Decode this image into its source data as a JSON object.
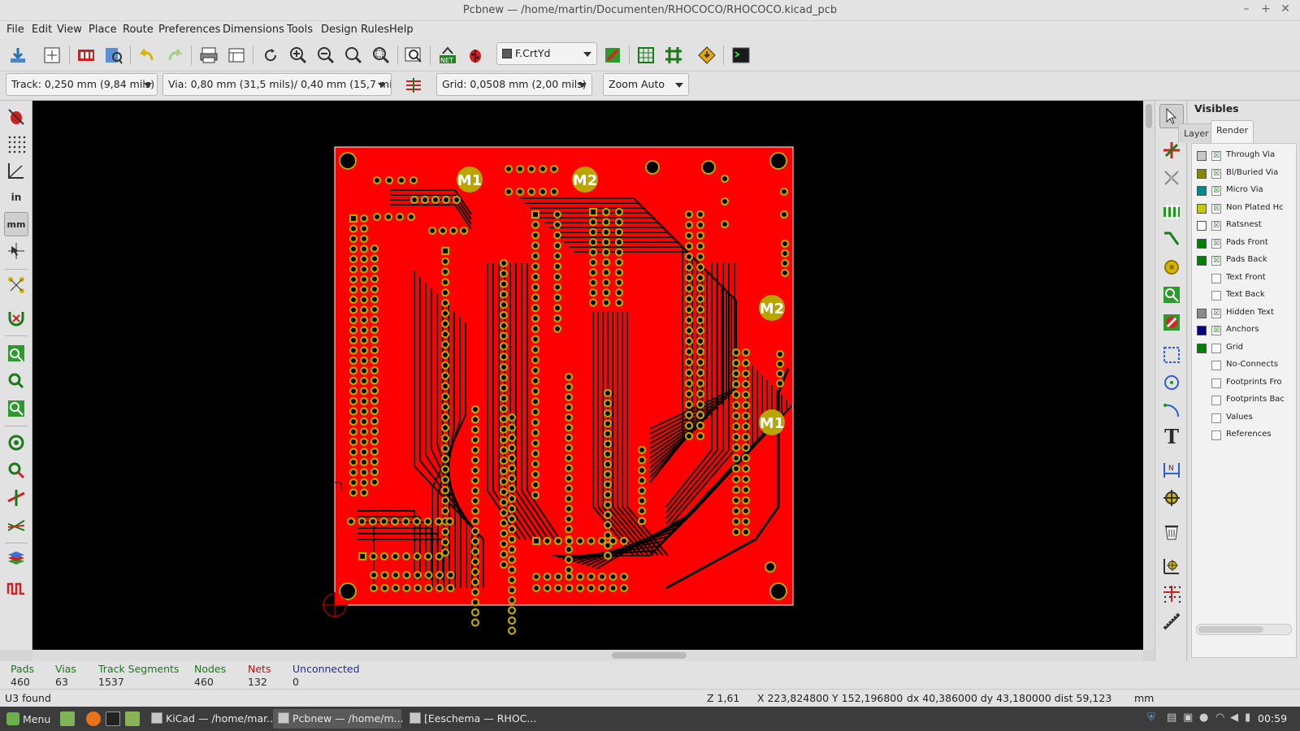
{
  "window": {
    "title": "Pcbnew — /home/martin/Documenten/RHOCOCO/RHOCOCO.kicad_pcb",
    "controls": [
      "–",
      "+",
      "✕"
    ]
  },
  "menu": [
    "File",
    "Edit",
    "View",
    "Place",
    "Route",
    "Preferences",
    "Dimensions",
    "Tools",
    "Design Rules",
    "Help"
  ],
  "toolbar": {
    "layer_select": "F.CrtYd",
    "layer_swatch_color": "#5a5a5a",
    "icons": [
      "save-board-icon",
      "page-settings-icon",
      "load-module-icon",
      "library-browser-icon",
      "undo-icon",
      "redo-icon",
      "print-icon",
      "plot-icon",
      "redraw-icon",
      "zoom-in-icon",
      "zoom-out-icon",
      "zoom-fit-icon",
      "zoom-selection-icon",
      "find-icon",
      "netlist-icon",
      "drc-icon",
      "layer-pair-icon",
      "autoplace-icon",
      "autoroute-icon",
      "microwave-icon",
      "scripting-console-icon"
    ]
  },
  "toolbar2": {
    "track": "Track: 0,250 mm (9,84 mils) *",
    "via": "Via: 0,80 mm (31,5 mils)/ 0,40 mm (15,7 mils) *",
    "grid": "Grid: 0,0508 mm (2,00 mils)",
    "zoom": "Zoom Auto"
  },
  "board": {
    "copper_color": "#ff0000",
    "pad_color": "#b9a400",
    "background": "#000000",
    "labels": [
      "M1",
      "M2",
      "M2",
      "M1"
    ]
  },
  "visibles": {
    "title": "Visibles",
    "tabs": [
      "Layer",
      "Render"
    ],
    "active_tab": "Render",
    "items": [
      {
        "label": "Through Via",
        "swatch": "#c8c8c8",
        "checked": true
      },
      {
        "label": "Bl/Buried Via",
        "swatch": "#8a8a00",
        "checked": true
      },
      {
        "label": "Micro Via",
        "swatch": "#008a8a",
        "checked": true
      },
      {
        "label": "Non Plated Hc",
        "swatch": "#c8c800",
        "checked": true
      },
      {
        "label": "Ratsnest",
        "swatch": "#ffffff",
        "checked": true
      },
      {
        "label": "Pads Front",
        "swatch": "#008000",
        "checked": true
      },
      {
        "label": "Pads Back",
        "swatch": "#008000",
        "checked": true
      },
      {
        "label": "Text Front",
        "swatch": "",
        "checked": false
      },
      {
        "label": "Text Back",
        "swatch": "",
        "checked": false
      },
      {
        "label": "Hidden Text",
        "swatch": "#8a8a8a",
        "checked": true
      },
      {
        "label": "Anchors",
        "swatch": "#000080",
        "checked": true
      },
      {
        "label": "Grid",
        "swatch": "#008000",
        "checked": false
      },
      {
        "label": "No-Connects",
        "swatch": "",
        "checked": false
      },
      {
        "label": "Footprints Fro",
        "swatch": "",
        "checked": false
      },
      {
        "label": "Footprints Bac",
        "swatch": "",
        "checked": false
      },
      {
        "label": "Values",
        "swatch": "",
        "checked": false
      },
      {
        "label": "References",
        "swatch": "",
        "checked": false
      }
    ]
  },
  "info": {
    "pads": {
      "label": "Pads",
      "value": "460"
    },
    "vias": {
      "label": "Vias",
      "value": "63"
    },
    "tracks": {
      "label": "Track Segments",
      "value": "1537"
    },
    "nodes": {
      "label": "Nodes",
      "value": "460"
    },
    "nets": {
      "label": "Nets",
      "value": "132"
    },
    "unconnected": {
      "label": "Unconnected",
      "value": "0"
    }
  },
  "status": {
    "message": "U3 found",
    "zoom": "Z 1,61",
    "xy": "X 223,824800  Y 152,196800",
    "delta": "dx 40,386000  dy 43,180000  dist 59,123",
    "units": "mm"
  },
  "taskbar": {
    "menu_label": "Menu",
    "windows": [
      "KiCad — /home/mar...",
      "Pcbnew — /home/m...",
      "[Eeschema — RHOC..."
    ],
    "clock": "00:59"
  }
}
